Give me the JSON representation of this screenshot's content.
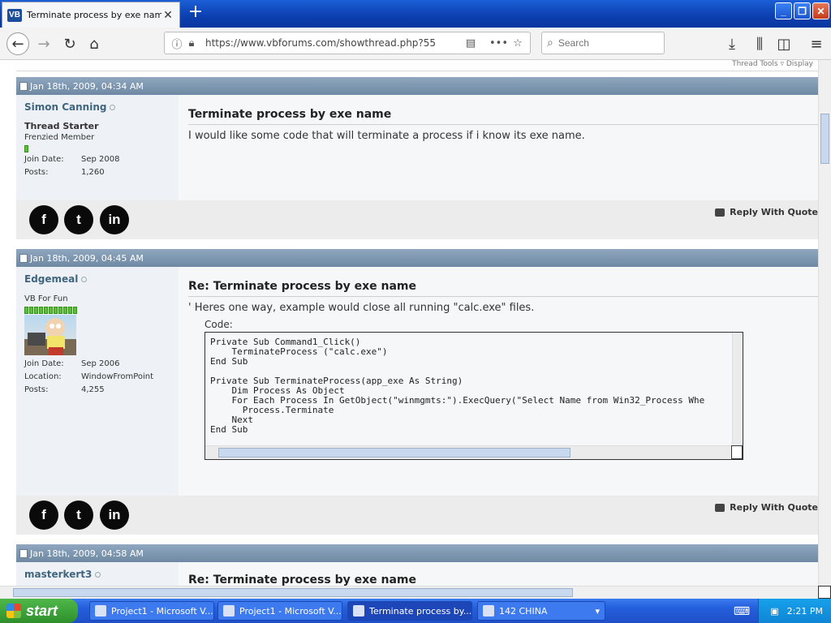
{
  "browser": {
    "tab_title": "Terminate process by exe name-VB",
    "tab_favicon": "VB",
    "url": "https://www.vbforums.com/showthread.php?55",
    "search_placeholder": "Search"
  },
  "page": {
    "top_strip": "Thread Tools ▿   Display",
    "reply_label": "Reply With Quote",
    "posts": [
      {
        "date": "Jan 18th, 2009, 04:34 AM",
        "username": "Simon Canning",
        "rank_title": "Thread Starter",
        "rank": "Frenzied Member",
        "rep_pips": 1,
        "join_date_label": "Join Date:",
        "join_date": "Sep 2008",
        "posts_label": "Posts:",
        "posts": "1,260",
        "title": "Terminate process by exe name",
        "body": "I would like some code that will terminate a process if i know its exe name."
      },
      {
        "date": "Jan 18th, 2009, 04:45 AM",
        "username": "Edgemeal",
        "rank": "VB For Fun",
        "rep_pips": 11,
        "join_date_label": "Join Date:",
        "join_date": "Sep 2006",
        "location_label": "Location:",
        "location": "WindowFromPoint",
        "posts_label": "Posts:",
        "posts": "4,255",
        "title": "Re: Terminate process by exe name",
        "body": "' Heres one way, example would close all running \"calc.exe\" files.",
        "code_label": "Code:",
        "code": "Private Sub Command1_Click()\n    TerminateProcess (\"calc.exe\")\nEnd Sub\n\nPrivate Sub TerminateProcess(app_exe As String)\n    Dim Process As Object\n    For Each Process In GetObject(\"winmgmts:\").ExecQuery(\"Select Name from Win32_Process Whe\n      Process.Terminate\n    Next\nEnd Sub"
      },
      {
        "date": "Jan 18th, 2009, 04:58 AM",
        "username": "masterkert3",
        "title": "Re: Terminate process by exe name"
      }
    ]
  },
  "taskbar": {
    "start_label": "start",
    "tasks": [
      "Project1 - Microsoft V...",
      "Project1 - Microsoft V...",
      "Terminate process by...",
      "142 CHINA"
    ],
    "clock": "2:21 PM"
  },
  "colors": {
    "post_header": "#7d97b1",
    "username": "#40657f",
    "taskbar": "#245edb",
    "start_button": "#3a9a35"
  }
}
